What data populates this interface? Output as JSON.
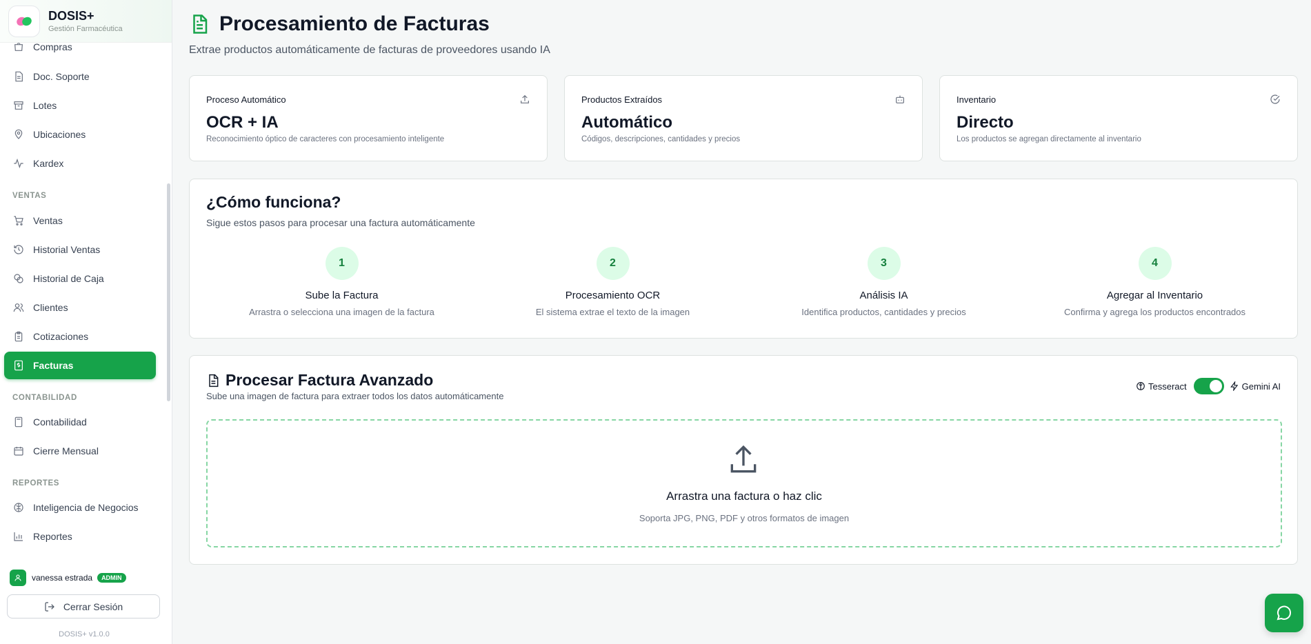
{
  "brand": {
    "name": "DOSIS+",
    "subtitle": "Gestión Farmacéutica"
  },
  "sidebar": {
    "partial_item": "Compras",
    "items_top": [
      {
        "label": "Doc. Soporte",
        "icon": "file-icon"
      },
      {
        "label": "Lotes",
        "icon": "archive-icon"
      },
      {
        "label": "Ubicaciones",
        "icon": "map-pin-icon"
      },
      {
        "label": "Kardex",
        "icon": "activity-icon"
      }
    ],
    "sections": {
      "ventas": "VENTAS",
      "contabilidad": "CONTABILIDAD",
      "reportes": "REPORTES"
    },
    "ventas_items": [
      {
        "label": "Ventas",
        "icon": "cart-icon"
      },
      {
        "label": "Historial Ventas",
        "icon": "history-icon"
      },
      {
        "label": "Historial de Caja",
        "icon": "coins-icon"
      },
      {
        "label": "Clientes",
        "icon": "users-icon"
      },
      {
        "label": "Cotizaciones",
        "icon": "clipboard-icon"
      },
      {
        "label": "Facturas",
        "icon": "invoice-icon",
        "active": true
      }
    ],
    "contabilidad_items": [
      {
        "label": "Contabilidad",
        "icon": "calculator-icon"
      },
      {
        "label": "Cierre Mensual",
        "icon": "calendar-icon"
      }
    ],
    "reportes_items": [
      {
        "label": "Inteligencia de Negocios",
        "icon": "brain-icon"
      },
      {
        "label": "Reportes",
        "icon": "bar-chart-icon"
      }
    ],
    "user": {
      "name": "vanessa estrada",
      "role": "ADMIN"
    },
    "logout_label": "Cerrar Sesión",
    "version": "DOSIS+ v1.0.0"
  },
  "header": {
    "title": "Procesamiento de Facturas",
    "subtitle": "Extrae productos automáticamente de facturas de proveedores usando IA"
  },
  "stats": [
    {
      "title": "Proceso Automático",
      "value": "OCR + IA",
      "desc": "Reconocimiento óptico de caracteres con procesamiento inteligente",
      "icon": "upload-icon"
    },
    {
      "title": "Productos Extraídos",
      "value": "Automático",
      "desc": "Códigos, descripciones, cantidades y precios",
      "icon": "bot-icon"
    },
    {
      "title": "Inventario",
      "value": "Directo",
      "desc": "Los productos se agregan directamente al inventario",
      "icon": "check-circle-icon"
    }
  ],
  "how": {
    "title": "¿Cómo funciona?",
    "subtitle": "Sigue estos pasos para procesar una factura automáticamente",
    "steps": [
      {
        "num": "1",
        "title": "Sube la Factura",
        "desc": "Arrastra o selecciona una imagen de la factura"
      },
      {
        "num": "2",
        "title": "Procesamiento OCR",
        "desc": "El sistema extrae el texto de la imagen"
      },
      {
        "num": "3",
        "title": "Análisis IA",
        "desc": "Identifica productos, cantidades y precios"
      },
      {
        "num": "4",
        "title": "Agregar al Inventario",
        "desc": "Confirma y agrega los productos encontrados"
      }
    ]
  },
  "processor": {
    "title": "Procesar Factura Avanzado",
    "subtitle": "Sube una imagen de factura para extraer todos los datos automáticamente",
    "engine_left": "Tesseract",
    "engine_right": "Gemini AI",
    "toggle_on": true,
    "drop_title": "Arrastra una factura o haz clic",
    "drop_sub": "Soporta JPG, PNG, PDF y otros formatos de imagen"
  },
  "colors": {
    "accent": "#16a34a",
    "accent_light": "#dcfce7",
    "background": "#f5f7f7"
  }
}
